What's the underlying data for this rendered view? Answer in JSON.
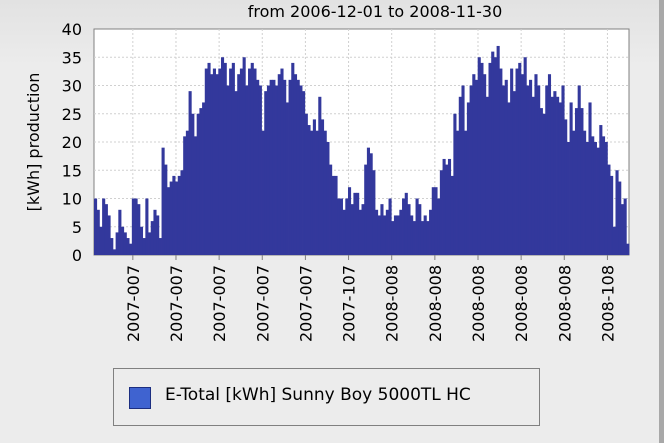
{
  "chart_data": {
    "type": "bar",
    "title": "from 2006-12-01 to 2008-11-30",
    "xlabel": "",
    "ylabel": "[kWh] production",
    "ylim": [
      0,
      40
    ],
    "yticks": [
      0,
      5,
      10,
      15,
      20,
      25,
      30,
      35,
      40
    ],
    "grid": true,
    "legend_position": "bottom",
    "bar_color": "#33389c",
    "xticks": [
      "2007-007",
      "2007-007",
      "2007-007",
      "2007-007",
      "2007-007",
      "2007-107",
      "2008-008",
      "2008-008",
      "2008-008",
      "2008-008",
      "2008-008",
      "2008-108"
    ],
    "series": [
      {
        "name": "E-Total [kWh] Sunny Boy 5000TL HC",
        "values": [
          10,
          8,
          5,
          10,
          9,
          7,
          3,
          1,
          4,
          8,
          5,
          4,
          3,
          2,
          10,
          10,
          9,
          5,
          3,
          10,
          4,
          6,
          8,
          7,
          3,
          19,
          16,
          12,
          13,
          14,
          13,
          14,
          15,
          21,
          22,
          29,
          25,
          21,
          25,
          26,
          27,
          33,
          34,
          32,
          33,
          32,
          33,
          35,
          34,
          30,
          33,
          34,
          29,
          32,
          33,
          35,
          30,
          33,
          34,
          33,
          31,
          30,
          22,
          29,
          30,
          31,
          31,
          30,
          32,
          33,
          31,
          27,
          31,
          34,
          32,
          31,
          30,
          29,
          25,
          23,
          22,
          24,
          22,
          28,
          24,
          22,
          20,
          16,
          14,
          14,
          10,
          10,
          8,
          10,
          12,
          9,
          11,
          11,
          8,
          9,
          16,
          19,
          18,
          15,
          8,
          7,
          9,
          7,
          8,
          10,
          6,
          7,
          7,
          8,
          10,
          11,
          9,
          7,
          6,
          10,
          9,
          6,
          7,
          6,
          8,
          12,
          12,
          10,
          15,
          17,
          16,
          17,
          14,
          25,
          22,
          28,
          30,
          22,
          27,
          30,
          32,
          31,
          35,
          34,
          32,
          28,
          34,
          36,
          35,
          37,
          33,
          30,
          31,
          27,
          33,
          29,
          33,
          34,
          32,
          35,
          30,
          31,
          28,
          32,
          30,
          26,
          25,
          30,
          32,
          28,
          29,
          28,
          27,
          30,
          24,
          20,
          27,
          22,
          26,
          30,
          26,
          22,
          20,
          27,
          21,
          20,
          19,
          23,
          21,
          20,
          16,
          14,
          5,
          15,
          13,
          9,
          10,
          2
        ]
      }
    ]
  }
}
